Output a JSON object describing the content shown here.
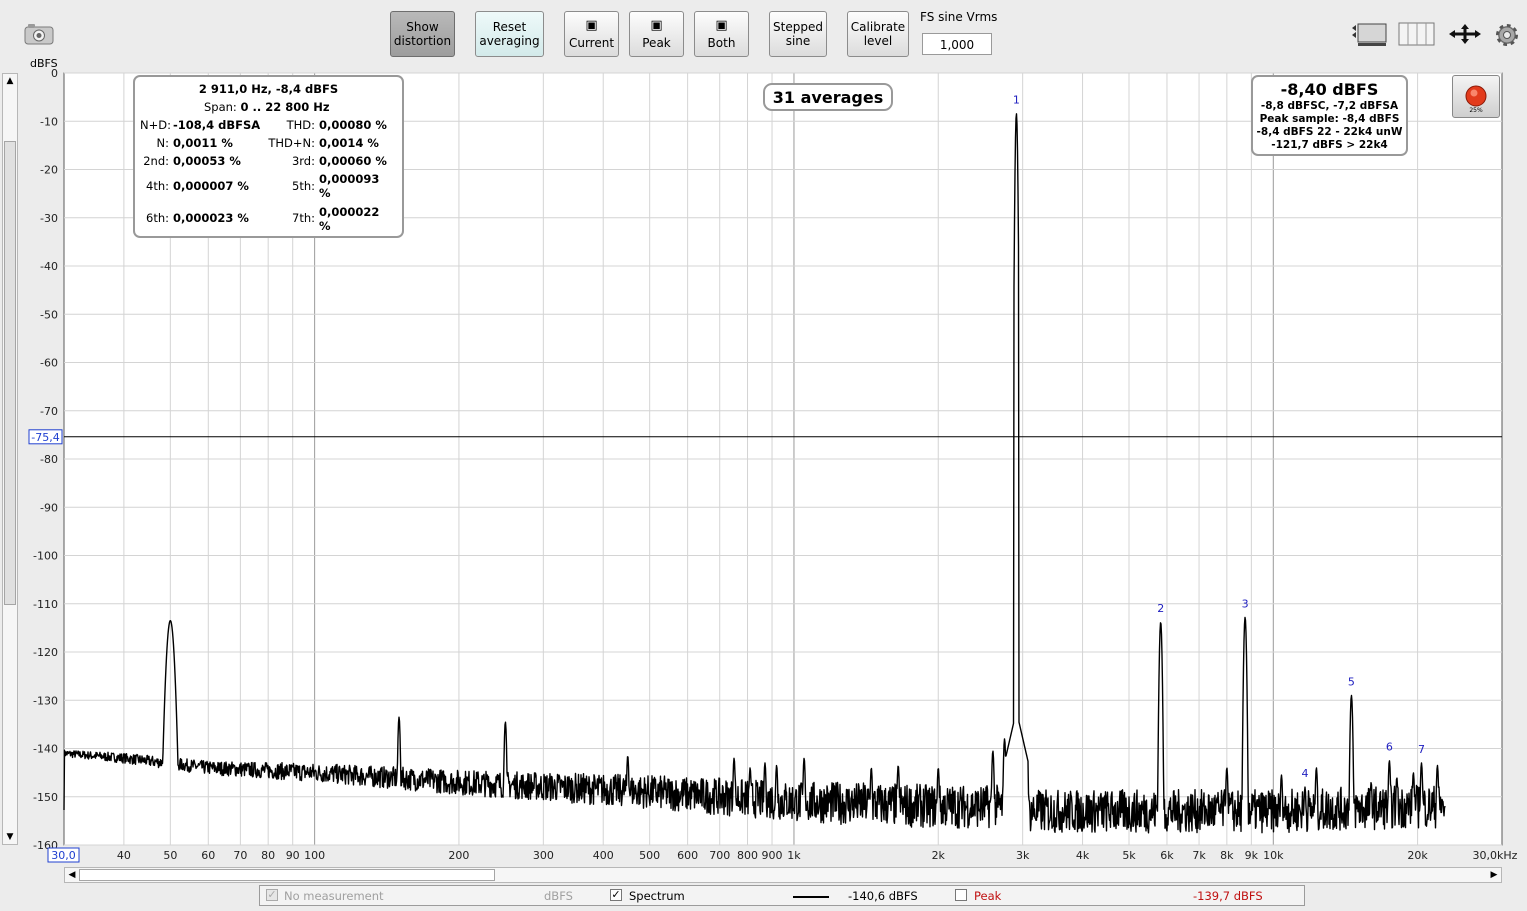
{
  "toolbar": {
    "buttons": [
      {
        "line1": "Show",
        "line2": "distortion"
      },
      {
        "line1": "Reset",
        "line2": "averaging"
      },
      {
        "label": "Current"
      },
      {
        "label": "Peak"
      },
      {
        "label": "Both"
      },
      {
        "line1": "Stepped",
        "line2": "sine"
      },
      {
        "line1": "Calibrate",
        "line2": "level"
      }
    ],
    "fs_label": "FS sine Vrms",
    "fs_value": "1,000"
  },
  "plot": {
    "y_unit": "dBFS",
    "cursor_label": "-75,4",
    "x_start_label": "30,0",
    "x_end_label": "30,0kHz",
    "averages": "31 averages",
    "harmonic_labels": [
      "1",
      "2",
      "3",
      "4",
      "5",
      "6",
      "7"
    ]
  },
  "stats": {
    "line1": "2 911,0 Hz, -8,4 dBFS",
    "span_label": "Span:",
    "span_value": "0 .. 22 800 Hz",
    "nd_label": "N+D:",
    "nd_value": "-108,4 dBFSA",
    "thd_label": "THD:",
    "thd_value": "0,00080 %",
    "n_label": "N:",
    "n_value": "0,0011 %",
    "thdn_label": "THD+N:",
    "thdn_value": "0,0014 %",
    "h2_label": "2nd:",
    "h2_value": "0,00053 %",
    "h3_label": "3rd:",
    "h3_value": "0,00060 %",
    "h4_label": "4th:",
    "h4_value": "0,000007 %",
    "h5_label": "5th:",
    "h5_value_a": "0,000093",
    "h5_value_b": "%",
    "h6_label": "6th:",
    "h6_value": "0,000023 %",
    "h7_label": "7th:",
    "h7_value_a": "0,000022",
    "h7_value_b": "%"
  },
  "level": {
    "main": "-8,40 dBFS",
    "l1": "-8,8 dBFSC, -7,2 dBFSA",
    "l2": "Peak sample: -8,4 dBFS",
    "l3": "-8,4 dBFS 22 - 22k4 unW",
    "l4": "-121,7 dBFS > 22k4",
    "record_pct": "25%"
  },
  "legend": {
    "no_measurement": "No measurement",
    "unit": "dBFS",
    "spectrum_label": "Spectrum",
    "spectrum_value": "-140,6 dBFS",
    "peak_label": "Peak",
    "peak_value": "-139,7 dBFS"
  },
  "colors": {
    "harmonic": "#2020c0",
    "peak": "#c01010",
    "cursor_box": "#2040d0"
  },
  "chart_data": {
    "type": "line",
    "x_scale": "log",
    "xlim": [
      30,
      30000
    ],
    "ylim": [
      -160,
      0
    ],
    "ylabel": "dBFS",
    "x_ticks": [
      {
        "v": 40,
        "t": "40"
      },
      {
        "v": 50,
        "t": "50"
      },
      {
        "v": 60,
        "t": "60"
      },
      {
        "v": 70,
        "t": "70"
      },
      {
        "v": 80,
        "t": "80"
      },
      {
        "v": 90,
        "t": "90"
      },
      {
        "v": 100,
        "t": "100"
      },
      {
        "v": 200,
        "t": "200"
      },
      {
        "v": 300,
        "t": "300"
      },
      {
        "v": 400,
        "t": "400"
      },
      {
        "v": 500,
        "t": "500"
      },
      {
        "v": 600,
        "t": "600"
      },
      {
        "v": 700,
        "t": "700"
      },
      {
        "v": 800,
        "t": "800"
      },
      {
        "v": 900,
        "t": "900"
      },
      {
        "v": 1000,
        "t": "1k"
      },
      {
        "v": 2000,
        "t": "2k"
      },
      {
        "v": 3000,
        "t": "3k"
      },
      {
        "v": 4000,
        "t": "4k"
      },
      {
        "v": 5000,
        "t": "5k"
      },
      {
        "v": 6000,
        "t": "6k"
      },
      {
        "v": 7000,
        "t": "7k"
      },
      {
        "v": 8000,
        "t": "8k"
      },
      {
        "v": 9000,
        "t": "9k"
      },
      {
        "v": 10000,
        "t": "10k"
      },
      {
        "v": 20000,
        "t": "20k"
      }
    ],
    "y_ticks": [
      "0",
      "-10",
      "-20",
      "-30",
      "-40",
      "-50",
      "-60",
      "-70",
      "-80",
      "-90",
      "-100",
      "-110",
      "-120",
      "-130",
      "-140",
      "-150",
      "-160"
    ],
    "cursor_y": -75.4,
    "series": [
      {
        "name": "Spectrum",
        "noise_floor": [
          [
            30,
            -141
          ],
          [
            40,
            -142
          ],
          [
            60,
            -144
          ],
          [
            100,
            -145
          ],
          [
            200,
            -147
          ],
          [
            500,
            -149
          ],
          [
            1000,
            -151
          ],
          [
            2000,
            -152
          ],
          [
            2800,
            -152
          ],
          [
            3100,
            -153
          ],
          [
            5000,
            -153
          ],
          [
            10000,
            -153
          ],
          [
            20000,
            -152
          ],
          [
            22800,
            -152
          ]
        ],
        "peaks": [
          {
            "f": 50,
            "db": -113.5
          },
          {
            "f": 150,
            "db": -133.5
          },
          {
            "f": 250,
            "db": -134.5
          },
          {
            "f": 450,
            "db": -141.5
          },
          {
            "f": 750,
            "db": -142
          },
          {
            "f": 810,
            "db": -144
          },
          {
            "f": 870,
            "db": -143
          },
          {
            "f": 920,
            "db": -143.5
          },
          {
            "f": 1050,
            "db": -142
          },
          {
            "f": 1450,
            "db": -144
          },
          {
            "f": 1650,
            "db": -143.5
          },
          {
            "f": 2000,
            "db": -144
          },
          {
            "f": 2600,
            "db": -140.5
          },
          {
            "f": 2750,
            "db": -138
          },
          {
            "f": 2911,
            "db": -8.4
          },
          {
            "f": 3000,
            "db": -139.5
          },
          {
            "f": 5822,
            "db": -113.8
          },
          {
            "f": 8000,
            "db": -144
          },
          {
            "f": 8733,
            "db": -112.8
          },
          {
            "f": 10400,
            "db": -145.5
          },
          {
            "f": 11644,
            "db": -148
          },
          {
            "f": 12300,
            "db": -144
          },
          {
            "f": 14555,
            "db": -129
          },
          {
            "f": 16000,
            "db": -147
          },
          {
            "f": 17466,
            "db": -142.5
          },
          {
            "f": 18100,
            "db": -146
          },
          {
            "f": 19600,
            "db": -145
          },
          {
            "f": 20377,
            "db": -143
          },
          {
            "f": 22000,
            "db": -143.5
          }
        ]
      }
    ],
    "harmonics": [
      {
        "n": "1",
        "f": 2911,
        "db": -8.4
      },
      {
        "n": "2",
        "f": 5822,
        "db": -113.8
      },
      {
        "n": "3",
        "f": 8733,
        "db": -112.8
      },
      {
        "n": "4",
        "f": 11644,
        "db": -148
      },
      {
        "n": "5",
        "f": 14555,
        "db": -129
      },
      {
        "n": "6",
        "f": 17466,
        "db": -142.5
      },
      {
        "n": "7",
        "f": 20377,
        "db": -143
      }
    ]
  }
}
